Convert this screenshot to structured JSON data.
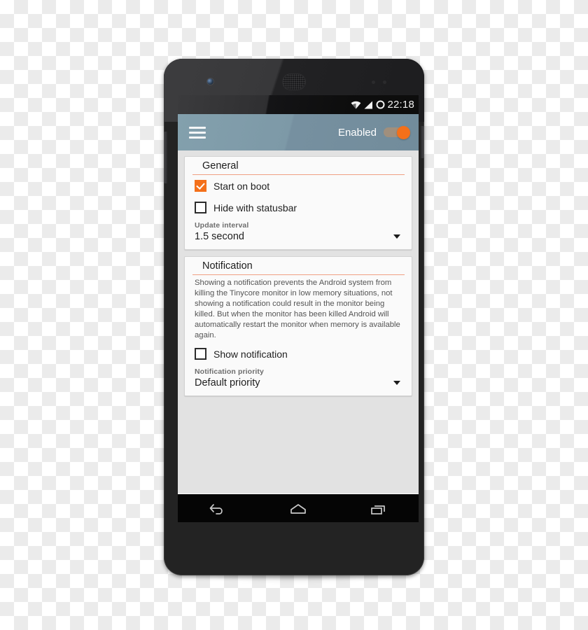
{
  "device": {
    "name": "android-phone-mockup",
    "camera": "front-camera",
    "speaker": "earpiece-speaker"
  },
  "statusbar": {
    "time": "22:18",
    "icons": [
      "wifi-icon",
      "cellular-signal-icon",
      "sync-circle-icon"
    ]
  },
  "actionbar": {
    "menu_icon": "hamburger-menu-icon",
    "switch_label": "Enabled",
    "switch_on": true,
    "background_color": "#7a94a3",
    "accent_color": "#f4701a"
  },
  "cards": [
    {
      "title": "General",
      "checkboxes": [
        {
          "label": "Start on boot",
          "checked": true
        },
        {
          "label": "Hide with statusbar",
          "checked": false
        }
      ],
      "field_label": "Update interval",
      "field_value": "1.5 second"
    },
    {
      "title": "Notification",
      "description": "Showing a notification prevents the Android system from killing the Tinycore monitor in low memory situations, not showing a notification could result in the monitor being killed. But when the monitor has been killed Android will automatically restart the monitor when memory is available again.",
      "checkboxes": [
        {
          "label": "Show notification",
          "checked": false
        }
      ],
      "field_label": "Notification priority",
      "field_value": "Default priority"
    }
  ],
  "navbar": {
    "back": "back-icon",
    "home": "home-icon",
    "recents": "recents-icon"
  }
}
